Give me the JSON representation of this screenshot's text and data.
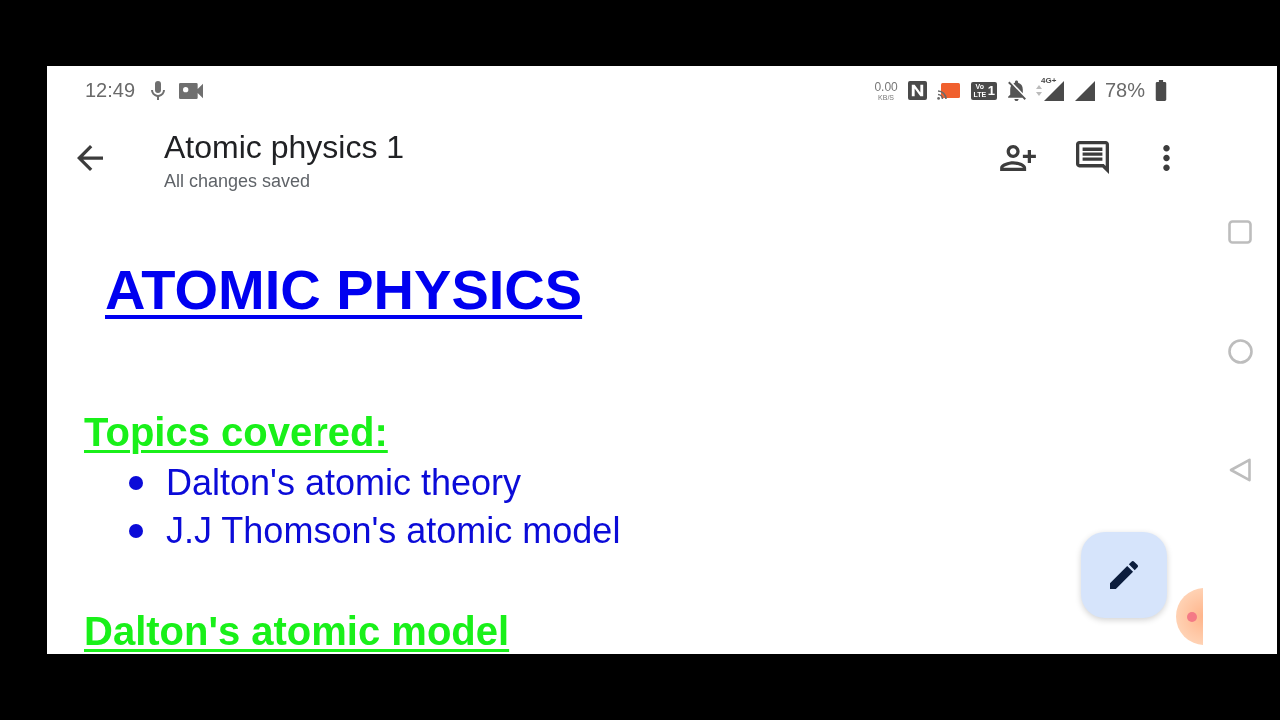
{
  "status_bar": {
    "time": "12:49",
    "data_rate": {
      "value": "0.00",
      "unit": "KB/S"
    },
    "volte": {
      "label": "Vo LTE",
      "sim": "1"
    },
    "network_type": "4G+",
    "battery": "78%"
  },
  "app_bar": {
    "title": "Atomic physics 1",
    "subtitle": "All changes saved"
  },
  "document": {
    "blocks": [
      {
        "kind": "title",
        "text": "ATOMIC PHYSICS"
      },
      {
        "kind": "heading",
        "text": "Topics covered:"
      },
      {
        "kind": "bullets",
        "items": [
          "Dalton's atomic theory",
          "J.J Thomson's atomic model"
        ]
      },
      {
        "kind": "heading",
        "text": "Dalton's atomic model"
      }
    ]
  }
}
